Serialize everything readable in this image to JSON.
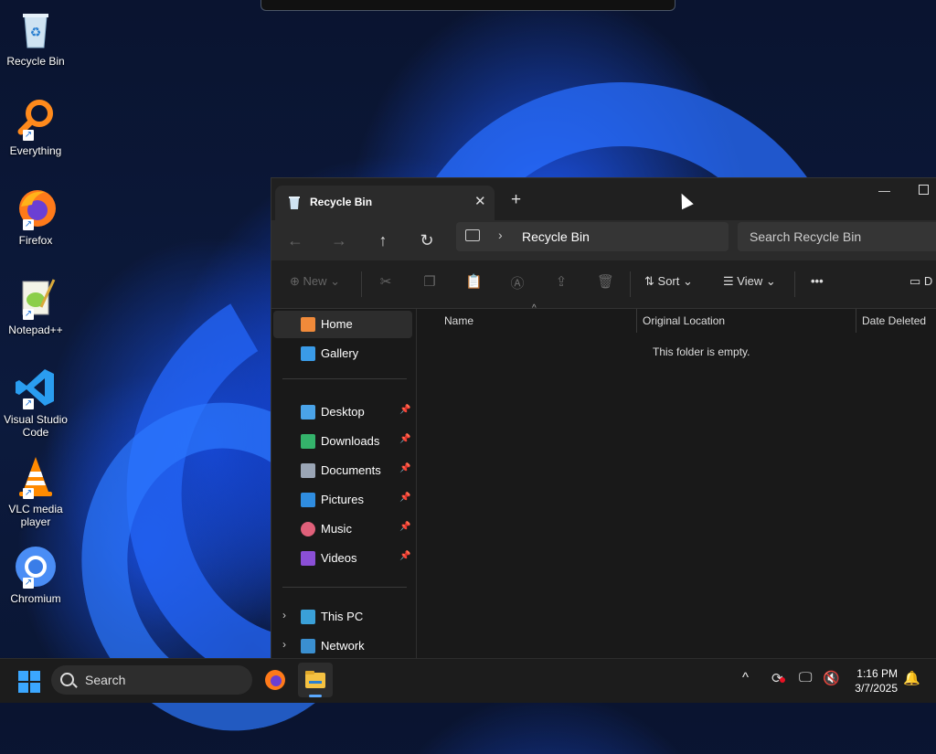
{
  "desktop": {
    "icons": [
      {
        "label": "Recycle Bin",
        "icon": "recycle-bin-icon"
      },
      {
        "label": "Everything",
        "icon": "everything-icon"
      },
      {
        "label": "Firefox",
        "icon": "firefox-icon"
      },
      {
        "label": "Notepad++",
        "icon": "notepadpp-icon"
      },
      {
        "label": "Visual Studio Code",
        "icon": "vscode-icon"
      },
      {
        "label": "VLC media player",
        "icon": "vlc-icon"
      },
      {
        "label": "Chromium",
        "icon": "chromium-icon"
      }
    ]
  },
  "explorer": {
    "tab": {
      "title": "Recycle Bin"
    },
    "address": {
      "location": "Recycle Bin"
    },
    "search": {
      "placeholder": "Search Recycle Bin"
    },
    "toolbar": {
      "new_label": "New",
      "sort_label": "Sort",
      "view_label": "View",
      "more_label": "•••",
      "details_label": "D"
    },
    "nav": {
      "home": "Home",
      "gallery": "Gallery",
      "quick": [
        {
          "label": "Desktop",
          "icon": "desktop-folder-icon",
          "color": "#4aa3e8"
        },
        {
          "label": "Downloads",
          "icon": "downloads-folder-icon",
          "color": "#34b36b"
        },
        {
          "label": "Documents",
          "icon": "documents-folder-icon",
          "color": "#9aa5b5"
        },
        {
          "label": "Pictures",
          "icon": "pictures-folder-icon",
          "color": "#2f8de0"
        },
        {
          "label": "Music",
          "icon": "music-folder-icon",
          "color": "#e0607a"
        },
        {
          "label": "Videos",
          "icon": "videos-folder-icon",
          "color": "#8a4fd6"
        }
      ],
      "this_pc": "This PC",
      "network": "Network"
    },
    "columns": [
      "Name",
      "Original Location",
      "Date Deleted"
    ],
    "empty_message": "This folder is empty."
  },
  "taskbar": {
    "search_label": "Search",
    "clock": {
      "time": "1:16 PM",
      "date": "3/7/2025"
    }
  }
}
